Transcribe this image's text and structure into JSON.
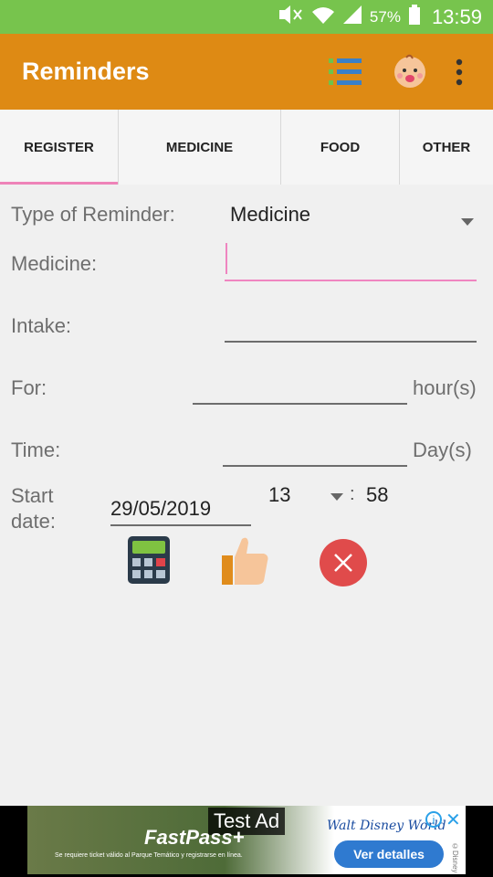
{
  "status_bar": {
    "battery": "57%",
    "time": "13:59"
  },
  "app_bar": {
    "title": "Reminders",
    "icons": [
      "list-icon",
      "baby-face-icon",
      "more-vert-icon"
    ]
  },
  "tabs": [
    {
      "label": "REGISTER",
      "active": true
    },
    {
      "label": "MEDICINE",
      "active": false
    },
    {
      "label": "FOOD",
      "active": false
    },
    {
      "label": "OTHER",
      "active": false
    }
  ],
  "form": {
    "type_label": "Type of Reminder:",
    "type_value": "Medicine",
    "medicine_label": "Medicine:",
    "medicine_value": "",
    "intake_label": "Intake:",
    "intake_value": "",
    "for_label": "For:",
    "for_value": "",
    "for_unit": "hour(s)",
    "time_label": "Time:",
    "time_value": "",
    "time_unit": "Day(s)",
    "start_label_line1": "Start",
    "start_label_line2": "date:",
    "start_date": "29/05/2019",
    "hour": "13",
    "separator": ":",
    "minute": "58"
  },
  "actions": [
    "calculator-icon",
    "thumbs-up-icon",
    "cancel-icon"
  ],
  "ad": {
    "badge": "Test Ad",
    "headline": "FastPass+",
    "small_text": "Se requiere ticket válido al Parque Temático y registrarse en línea.",
    "brand": "Walt Disney World",
    "cta": "Ver detalles",
    "copyright": "©Disney",
    "info_glyph": "i",
    "close_glyph": "✕"
  },
  "colors": {
    "status_bar": "#77c44d",
    "app_bar": "#de8a14",
    "accent": "#ef85c0",
    "cancel": "#e04b4b"
  }
}
